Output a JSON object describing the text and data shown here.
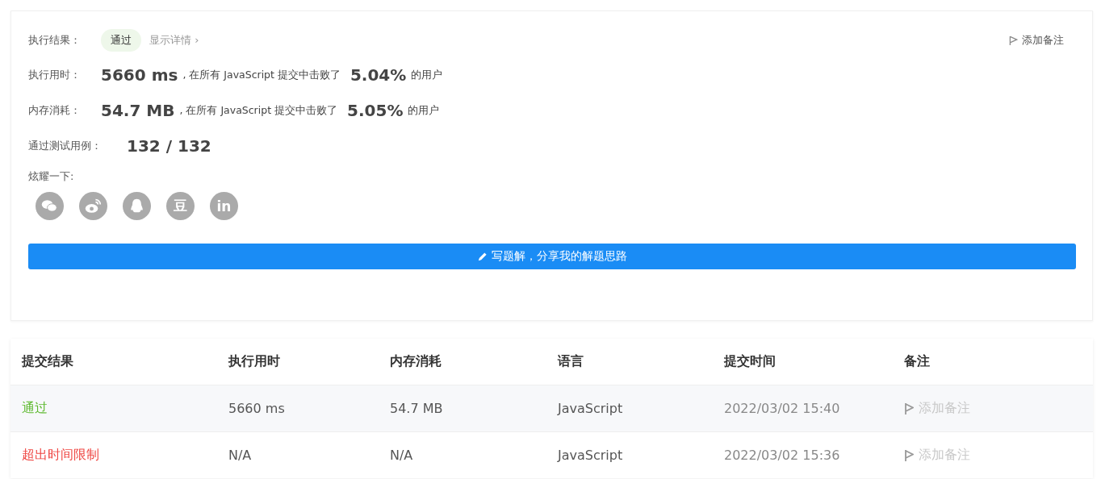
{
  "result": {
    "label": "执行结果：",
    "status": "通过",
    "details_link": "显示详情 ›",
    "add_note": "添加备注"
  },
  "stats": [
    {
      "label": "执行用时：",
      "value": "5660 ms",
      "middle": ", 在所有 JavaScript 提交中击败了",
      "percent": "5.04%",
      "suffix": "的用户"
    },
    {
      "label": "内存消耗：",
      "value": "54.7 MB",
      "middle": ", 在所有 JavaScript 提交中击败了",
      "percent": "5.05%",
      "suffix": "的用户"
    }
  ],
  "tests": {
    "label": "通过测试用例：",
    "value": "132 / 132"
  },
  "share": {
    "label": "炫耀一下:",
    "icons": [
      {
        "kind": "wechat"
      },
      {
        "kind": "weibo"
      },
      {
        "kind": "qq"
      },
      {
        "kind": "douban",
        "glyph": "豆"
      },
      {
        "kind": "linkedin",
        "glyph": "in"
      }
    ]
  },
  "write_button": "写题解，分享我的解题思路",
  "table": {
    "columns": [
      "提交结果",
      "执行用时",
      "内存消耗",
      "语言",
      "提交时间",
      "备注"
    ],
    "rows": [
      {
        "status": "通过",
        "color": "#5cb82d",
        "time": "5660 ms",
        "memory": "54.7 MB",
        "language": "JavaScript",
        "submitted": "2022/03/02 15:40",
        "note": "添加备注"
      },
      {
        "status": "超出时间限制",
        "color": "#ef4743",
        "time": "N/A",
        "memory": "N/A",
        "language": "JavaScript",
        "submitted": "2022/03/02 15:36",
        "note": "添加备注"
      }
    ]
  }
}
